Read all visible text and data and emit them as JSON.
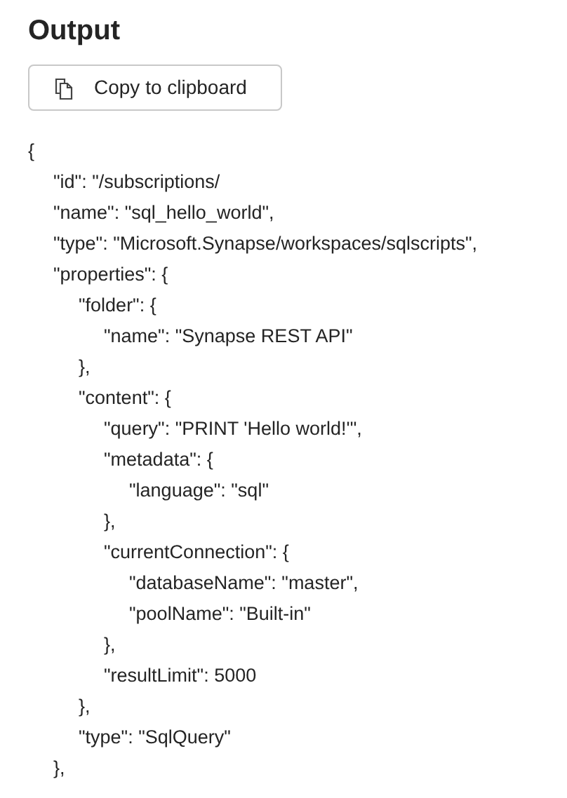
{
  "title": "Output",
  "copy_button": {
    "label": "Copy to clipboard"
  },
  "code_lines": [
    {
      "text": "{",
      "children": [
        {
          "text": "\"id\": \"/subscriptions/"
        },
        {
          "text": "\"name\": \"sql_hello_world\","
        },
        {
          "text": "\"type\": \"Microsoft.Synapse/workspaces/sqlscripts\","
        },
        {
          "text": "\"properties\": {",
          "children": [
            {
              "text": "\"folder\": {",
              "children": [
                {
                  "text": "\"name\": \"Synapse REST API\""
                }
              ]
            },
            {
              "text": "},"
            },
            {
              "text": "\"content\": {",
              "children": [
                {
                  "text": "\"query\": \"PRINT 'Hello world!'\","
                },
                {
                  "text": "\"metadata\": {",
                  "children": [
                    {
                      "text": "\"language\": \"sql\""
                    }
                  ]
                },
                {
                  "text": "},"
                },
                {
                  "text": "\"currentConnection\": {",
                  "children": [
                    {
                      "text": "\"databaseName\": \"master\","
                    },
                    {
                      "text": "\"poolName\": \"Built-in\""
                    }
                  ]
                },
                {
                  "text": "},"
                },
                {
                  "text": "\"resultLimit\": 5000"
                }
              ]
            },
            {
              "text": "},"
            },
            {
              "text": "\"type\": \"SqlQuery\""
            }
          ]
        },
        {
          "text": "},"
        }
      ]
    }
  ]
}
